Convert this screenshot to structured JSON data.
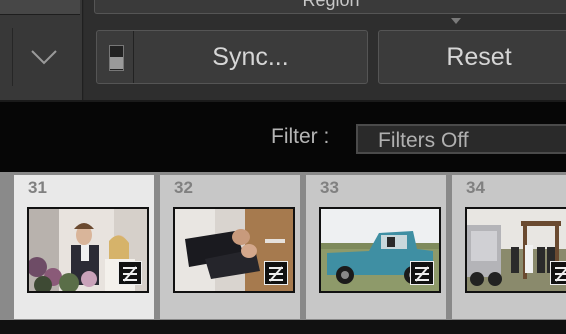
{
  "panel": {
    "region_label": "Region",
    "sync_label": "Sync...",
    "reset_label": "Reset"
  },
  "filter": {
    "label": "Filter :",
    "value": "Filters Off"
  },
  "filmstrip": {
    "cells": [
      {
        "number": "31",
        "selected": true,
        "badge_icon": "develop-adjustment-badge-icon"
      },
      {
        "number": "32",
        "selected": false,
        "badge_icon": "develop-adjustment-badge-icon"
      },
      {
        "number": "33",
        "selected": false,
        "badge_icon": "develop-adjustment-badge-icon"
      },
      {
        "number": "34",
        "selected": false,
        "badge_icon": "develop-adjustment-badge-icon"
      }
    ]
  },
  "icons": {
    "menu_toggle": "triangle-down-icon",
    "panel_collapse": "triangle-small-down-icon",
    "sync_switch": "toggle-switch-icon"
  },
  "colors": {
    "panel_bg": "#2e2e2e",
    "button_bg": "#3b3b3b",
    "filter_bar_bg": "#060606",
    "cell_bg": "#c7c7c7",
    "cell_selected_bg": "#e9e9e9"
  }
}
